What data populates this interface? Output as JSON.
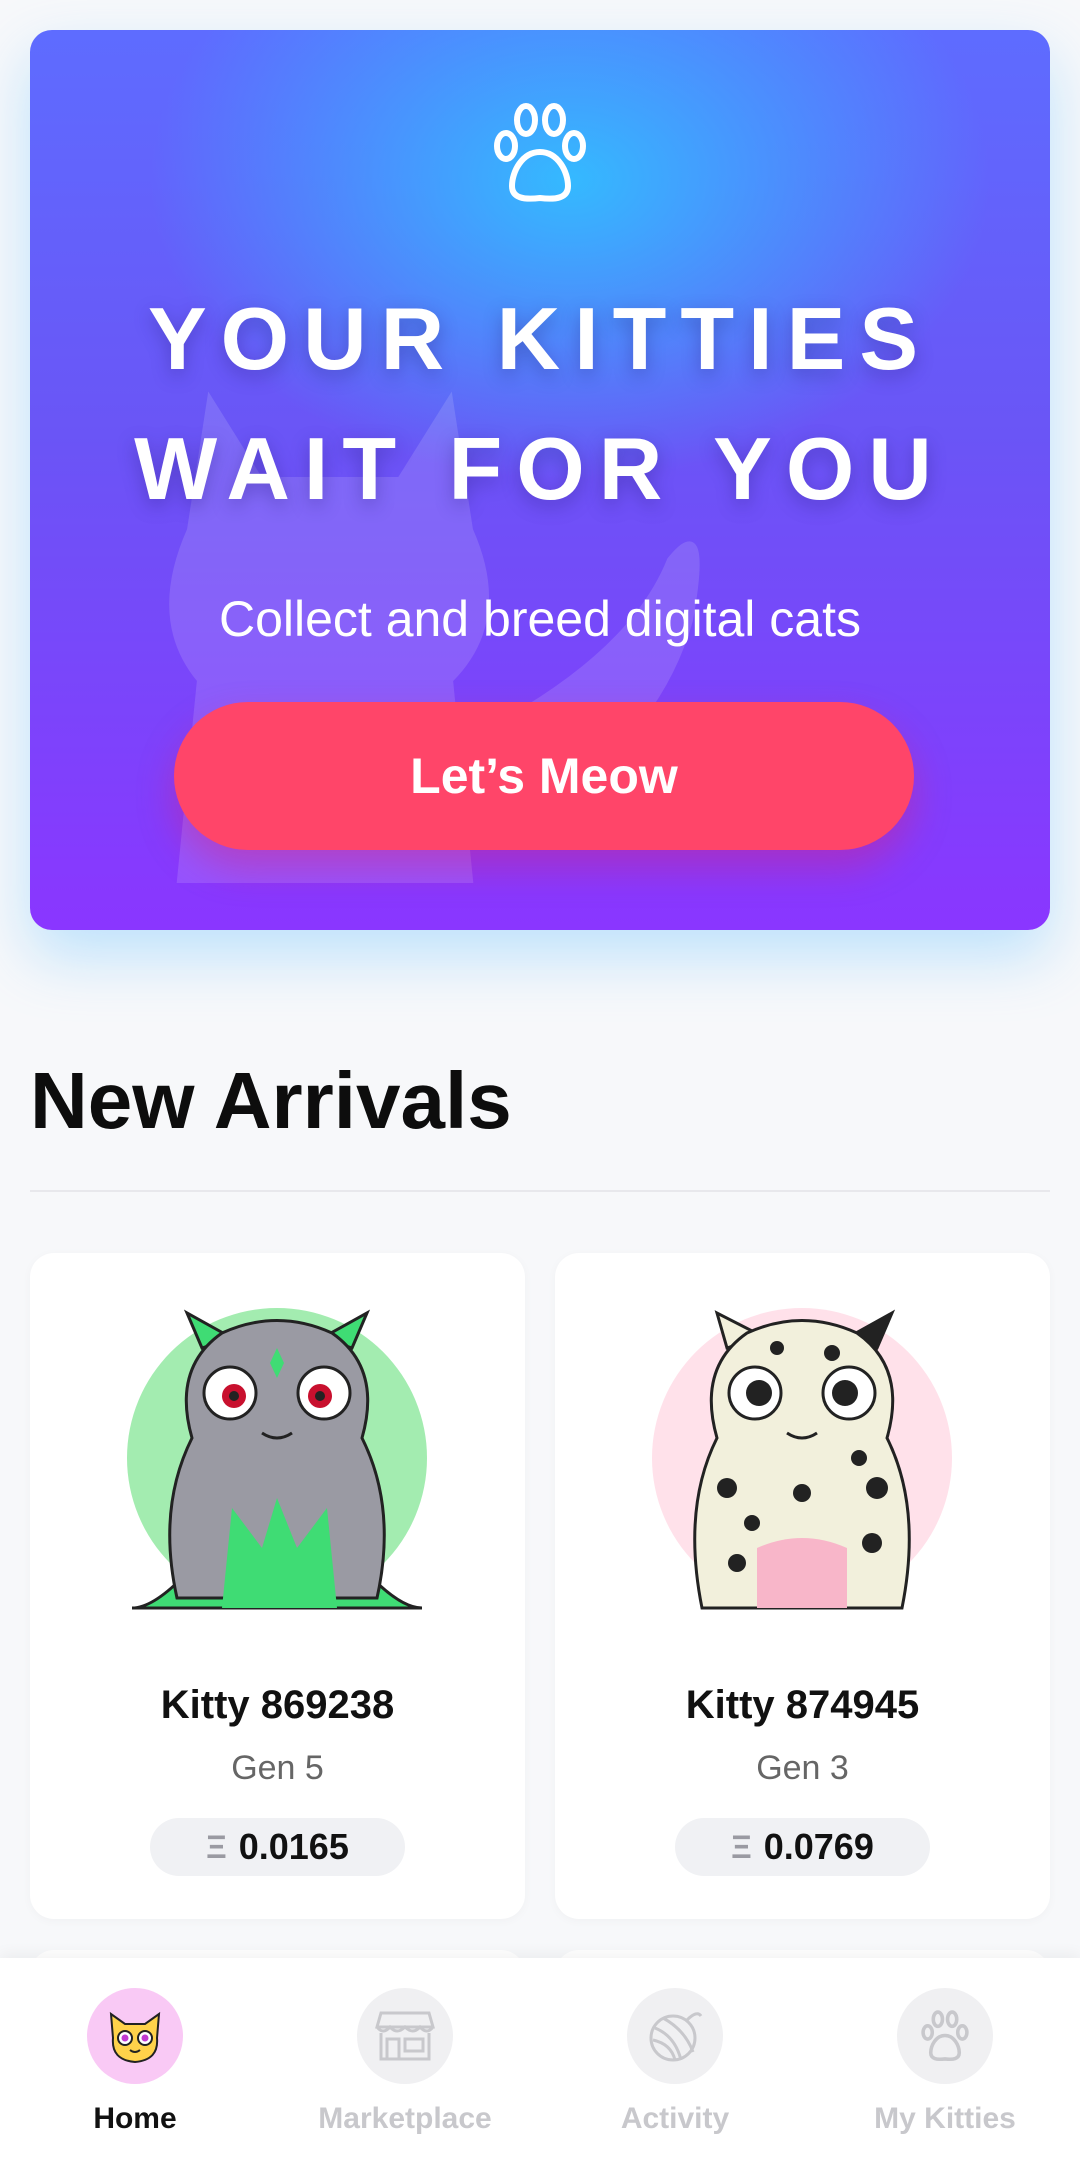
{
  "hero": {
    "title_line1": "YOUR KITTIES",
    "title_line2": "WAIT FOR YOU",
    "subtitle": "Collect and breed digital cats",
    "cta_label": "Let’s Meow",
    "gradient_colors": [
      "#32beff",
      "#5e6cff",
      "#8a36ff"
    ],
    "cta_color": "#ff4569"
  },
  "section": {
    "title": "New Arrivals"
  },
  "kitties": [
    {
      "name": "Kitty 869238",
      "gen": "Gen 5",
      "price": "0.0165",
      "currency_icon": "eth-icon",
      "bg_color": "#a3ecb0",
      "body_color": "#9a9aa3",
      "accent_color": "#3fdc74"
    },
    {
      "name": "Kitty 874945",
      "gen": "Gen 3",
      "price": "0.0769",
      "currency_icon": "eth-icon",
      "bg_color": "#ffe1ea",
      "body_color": "#f2f0dc",
      "accent_color": "#f8b6c9"
    }
  ],
  "bottom_nav": {
    "items": [
      {
        "label": "Home",
        "icon": "kitty-face-icon",
        "active": true
      },
      {
        "label": "Marketplace",
        "icon": "store-icon",
        "active": false
      },
      {
        "label": "Activity",
        "icon": "yarn-ball-icon",
        "active": false
      },
      {
        "label": "My Kitties",
        "icon": "paw-icon",
        "active": false
      }
    ]
  }
}
